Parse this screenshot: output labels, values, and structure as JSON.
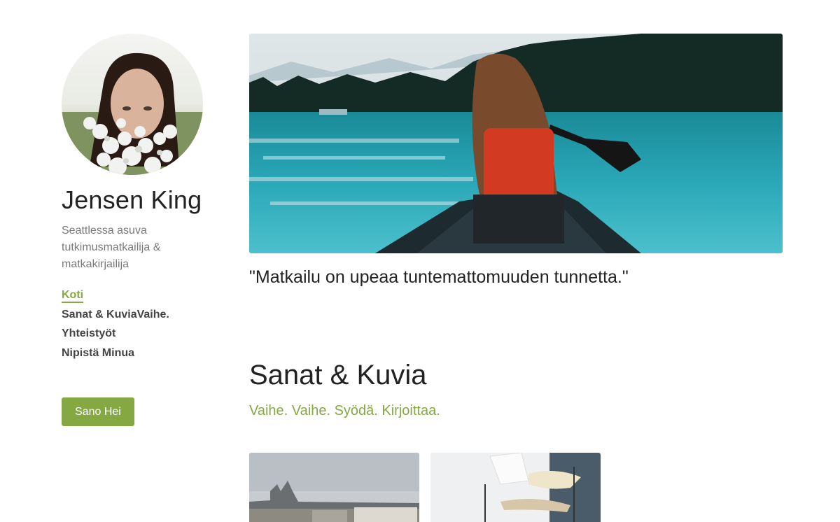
{
  "profile": {
    "name": "Jensen King",
    "tagline": "Seattlessa asuva tutkimusmatkailija & matkakirjailija"
  },
  "nav": {
    "items": [
      {
        "label": "Koti",
        "active": true
      },
      {
        "label": "Sanat & KuviaVaihe.",
        "active": false
      },
      {
        "label": "Yhteistyöt",
        "active": false
      },
      {
        "label": "Nipistä Minua",
        "active": false
      }
    ]
  },
  "cta": {
    "label": "Sano Hei"
  },
  "hero": {
    "quote": "\"Matkailu on upeaa tuntemattomuuden tunnetta.\""
  },
  "section": {
    "title": "Sanat & Kuvia",
    "subtitle": "Vaihe. Vaihe. Syödä. Kirjoittaa."
  },
  "colors": {
    "accent": "#86a843",
    "text": "#222222",
    "muted": "#7a7a7a"
  }
}
